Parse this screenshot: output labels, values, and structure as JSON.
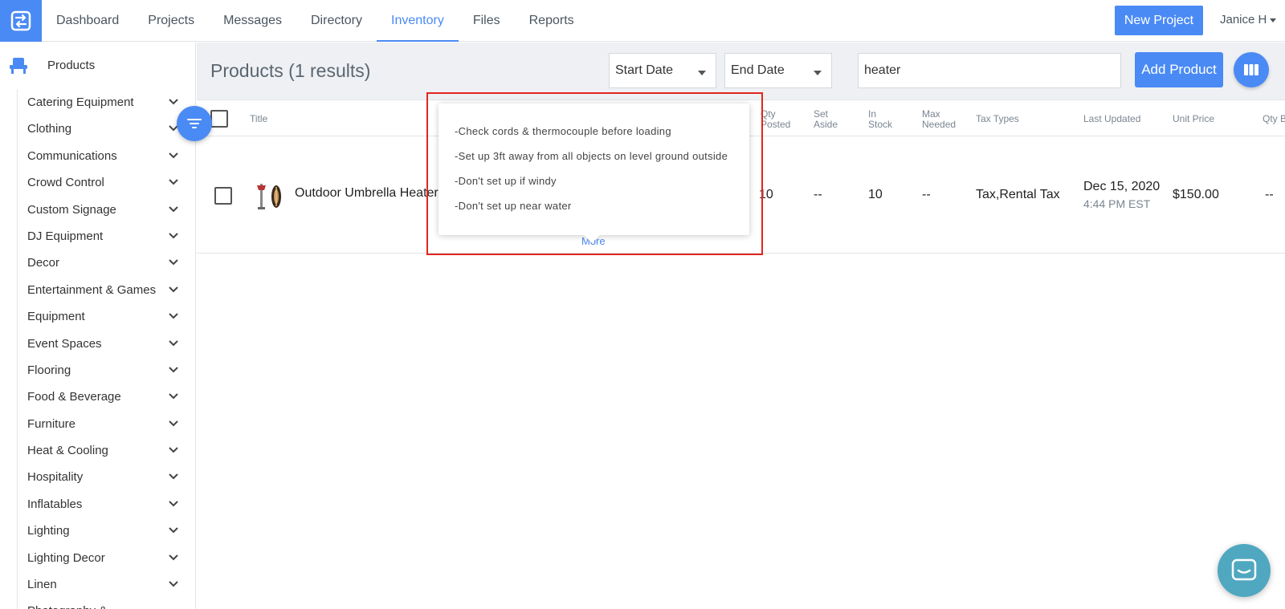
{
  "nav": {
    "items": [
      {
        "label": "Dashboard",
        "name": "nav-dashboard"
      },
      {
        "label": "Projects",
        "name": "nav-projects"
      },
      {
        "label": "Messages",
        "name": "nav-messages"
      },
      {
        "label": "Directory",
        "name": "nav-directory"
      },
      {
        "label": "Inventory",
        "name": "nav-inventory"
      },
      {
        "label": "Files",
        "name": "nav-files"
      },
      {
        "label": "Reports",
        "name": "nav-reports"
      }
    ],
    "active": "Inventory",
    "new_project_label": "New Project",
    "user_name": "Janice H"
  },
  "sidebar": {
    "title": "Products",
    "categories": [
      "Catering Equipment",
      "Clothing",
      "Communications",
      "Crowd Control",
      "Custom Signage",
      "DJ Equipment",
      "Decor",
      "Entertainment & Games",
      "Equipment",
      "Event Spaces",
      "Flooring",
      "Food & Beverage",
      "Furniture",
      "Heat & Cooling",
      "Hospitality",
      "Inflatables",
      "Lighting",
      "Lighting Decor",
      "Linen",
      "Photography &"
    ]
  },
  "toolbar": {
    "title": "Products (1 results)",
    "start_date_label": "Start Date",
    "end_date_label": "End Date",
    "search_value": "heater",
    "add_product_label": "Add Product"
  },
  "table": {
    "headers": {
      "title": "Title",
      "qty_posted": "Qty Posted",
      "set_aside": "Set Aside",
      "in_stock": "In Stock",
      "max_needed": "Max Needed",
      "tax_types": "Tax Types",
      "last_updated": "Last Updated",
      "unit_price": "Unit Price",
      "qty_b": "Qty B"
    },
    "row": {
      "title": "Outdoor Umbrella Heater",
      "more_link": "More",
      "qty_posted": "10",
      "set_aside": "--",
      "in_stock": "10",
      "max_needed": "--",
      "tax_types": "Tax,Rental Tax",
      "last_updated_date": "Dec 15, 2020",
      "last_updated_time": "4:44 PM EST",
      "unit_price": "$150.00",
      "qty_b": "--"
    }
  },
  "popover": {
    "notes": [
      "-Check cords & thermocouple before loading",
      "-Set up 3ft away from all objects on level ground outside",
      "-Don't set up if windy",
      "-Don't set up near water"
    ]
  },
  "colors": {
    "accent": "#4a8af4",
    "highlight_border": "#e0261e",
    "chat": "#4fa8c0"
  }
}
